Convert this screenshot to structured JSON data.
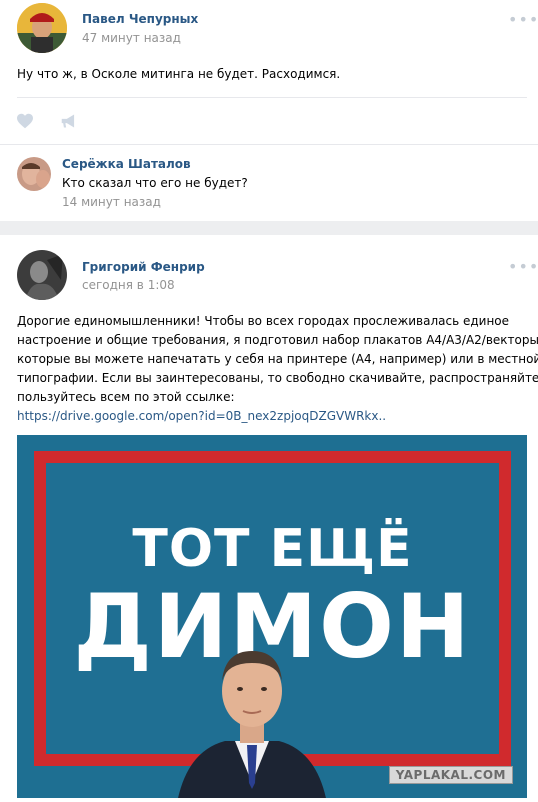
{
  "post1": {
    "author": "Павел Чепурных",
    "time": "47 минут назад",
    "text": "Ну что ж, в Осколе митинга не будет. Расходимся.",
    "menu_icon": "more-dots-icon",
    "actions": {
      "like_icon": "heart-icon",
      "share_icon": "megaphone-icon"
    },
    "comment": {
      "author": "Серёжка Шаталов",
      "text": "Кто сказал что его не будет?",
      "time": "14 минут назад"
    }
  },
  "post2": {
    "author": "Григорий Фенрир",
    "time": "сегодня в 1:08",
    "text_lines": [
      "Дорогие единомышленники! Чтобы во всех городах прослеживалась единое",
      "настроение и общие требования, я подготовил набор плакатов А4/А3/А2/векторы,",
      "которые вы можете напечатать у себя на принтере (А4, например) или в местной",
      "типографии. Если вы заинтересованы, то свободно скачивайте, распространяйте и",
      "пользуйтесь всем по этой ссылке:"
    ],
    "link": "https://drive.google.com/open?id=0B_nex2zpjoqDZGVWRkx..",
    "menu_icon": "more-dots-icon",
    "poster": {
      "line1": "ТОТ ЕЩЁ",
      "line2": "ДИМОН",
      "colors": {
        "background": "#1e6f92",
        "frame": "#d02a2d",
        "text": "#ffffff"
      }
    }
  },
  "watermark": "YAPLAKAL.COM"
}
